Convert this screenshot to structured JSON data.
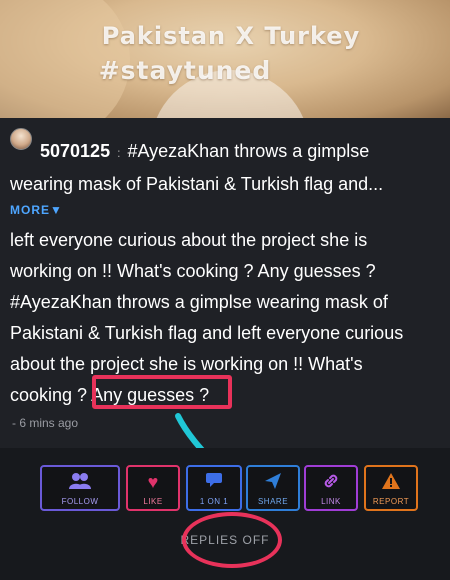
{
  "banner": {
    "line1": "Pakistan X Turkey",
    "line2": "#staytuned"
  },
  "post": {
    "user_id": "5070125",
    "separator": ":",
    "headline_lines": [
      "#AyezaKhan throws a gimplse",
      "wearing mask of Pakistani & Turkish flag and..."
    ],
    "more_label": "MORE",
    "more_icon": "caret-down-icon",
    "body_lines": [
      "left everyone curious about the project she is",
      "working on !! What's cooking ? Any guesses ?",
      "#AyezaKhan throws a gimplse wearing mask of",
      "Pakistani & Turkish flag and left everyone curious",
      "about the project she is working on !! What's"
    ],
    "last_line_prefix": "cooking ? ",
    "highlighted_text": "Any guesses ?",
    "timestamp": "- 6 mins ago"
  },
  "actions": [
    {
      "label": "FOLLOW",
      "icon": "users-icon",
      "color": "#6a5ad8"
    },
    {
      "label": "LIKE",
      "icon": "heart-icon",
      "color": "#e0336b"
    },
    {
      "label": "1 ON 1",
      "icon": "chat-icon",
      "color": "#3d6ee8"
    },
    {
      "label": "SHARE",
      "icon": "send-icon",
      "color": "#2f7ed8"
    },
    {
      "label": "LINK",
      "icon": "link-icon",
      "color": "#a03dd6"
    },
    {
      "label": "REPORT",
      "icon": "warning-icon",
      "color": "#e0741c"
    }
  ],
  "replies_label": "REPLIES OFF",
  "colors": {
    "highlight": "#e8325a",
    "arrow": "#20c7d6",
    "more": "#4ea6ff"
  }
}
